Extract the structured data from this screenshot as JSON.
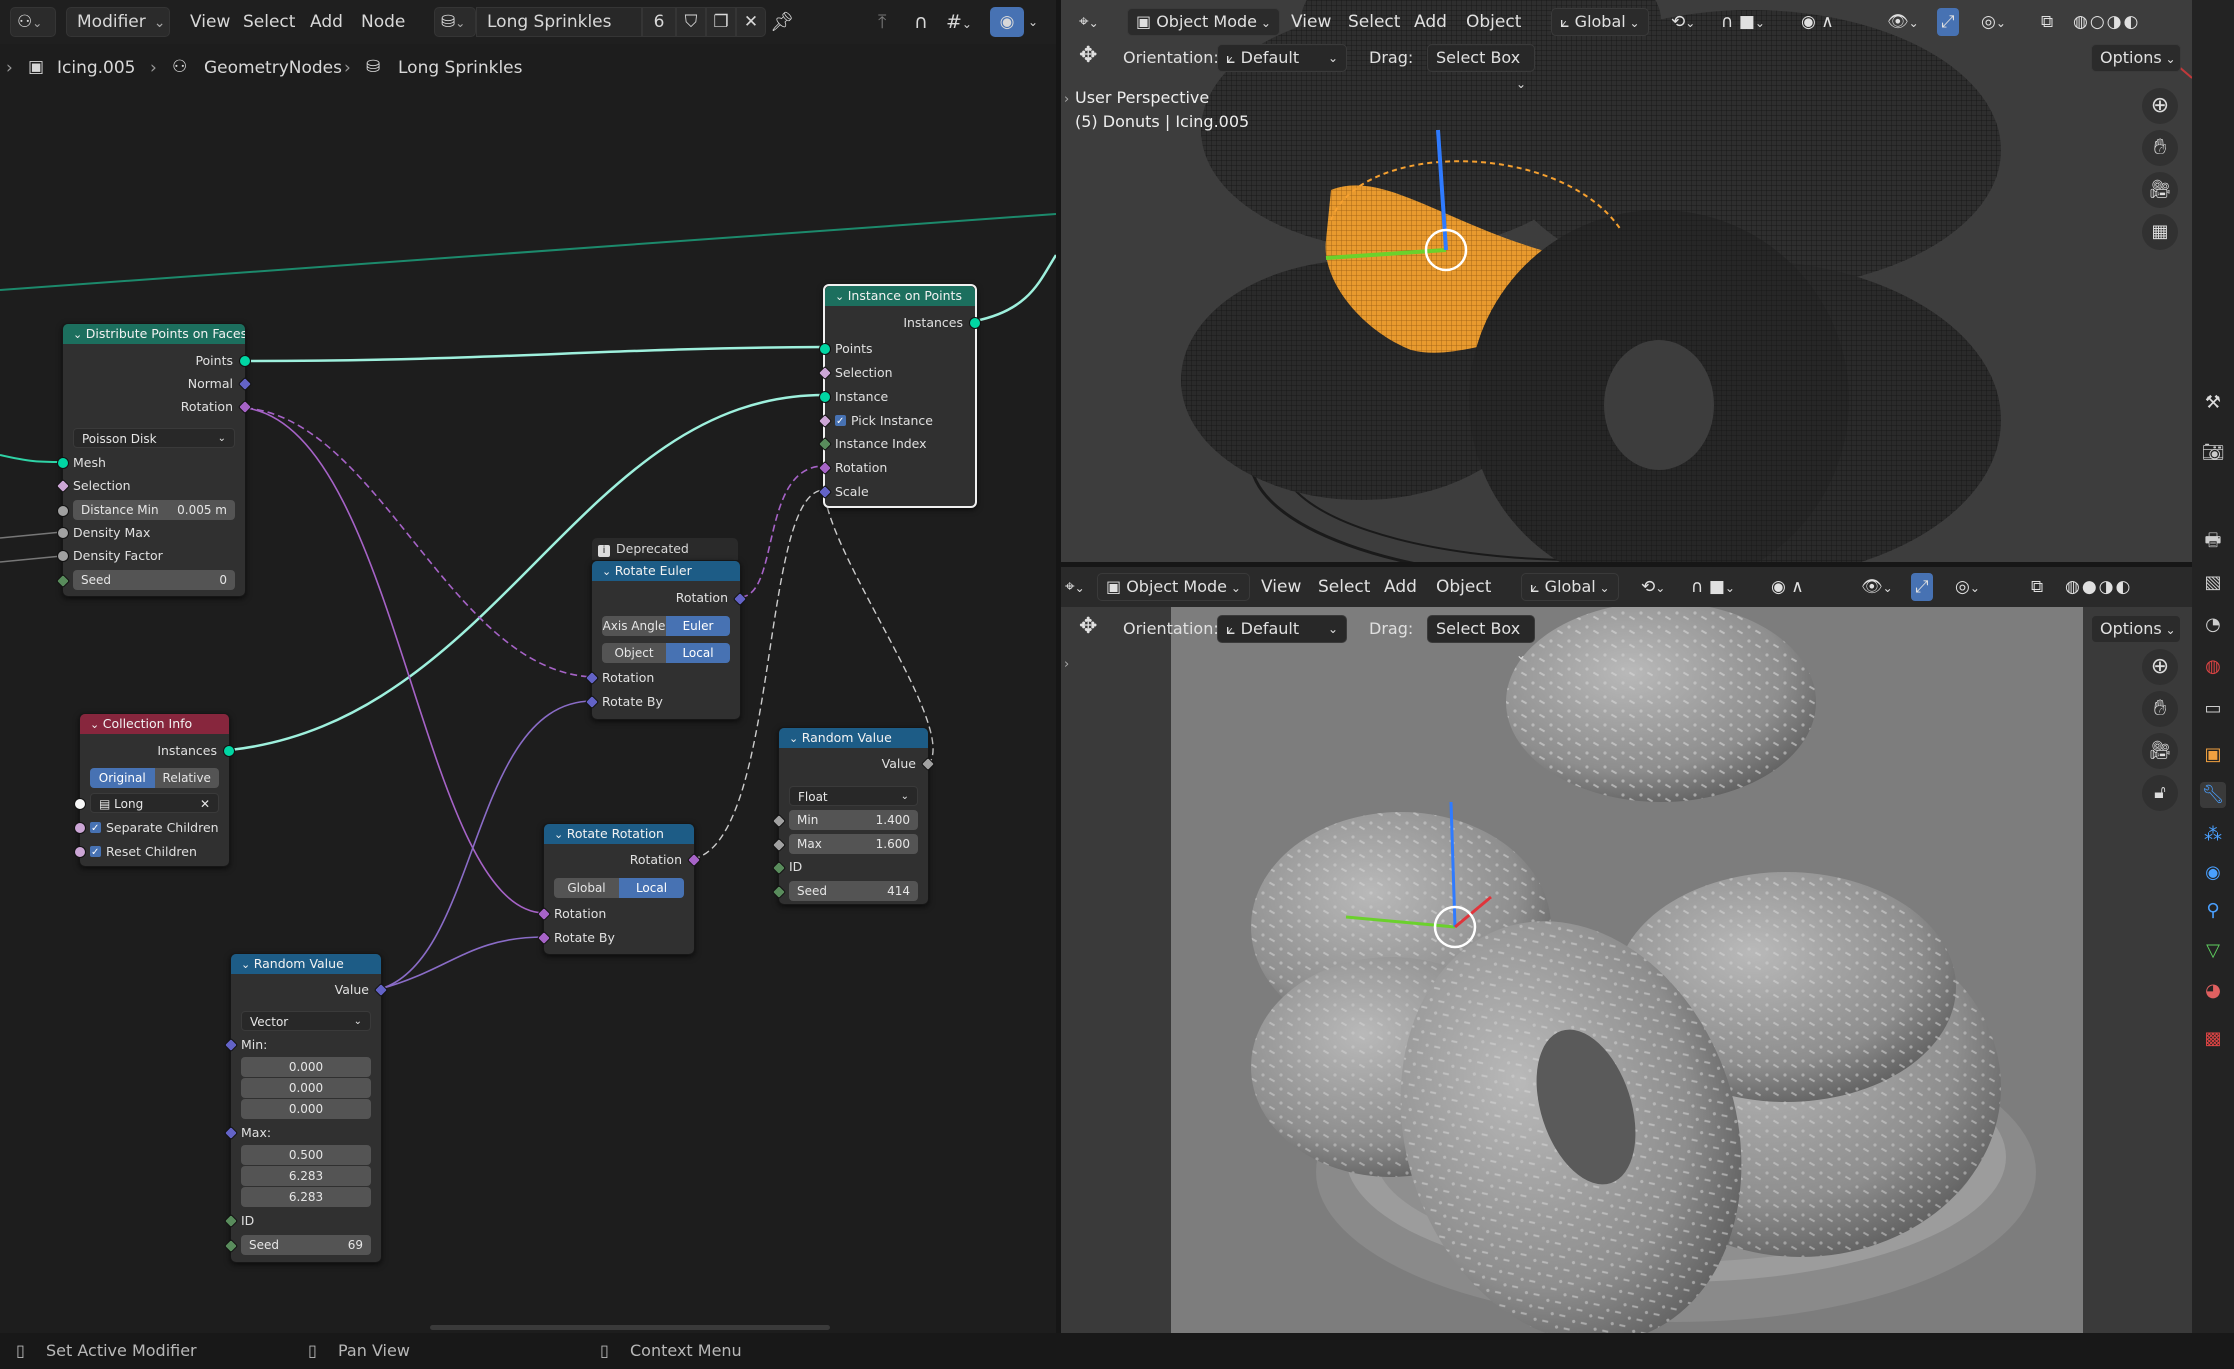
{
  "node_editor": {
    "header": {
      "editor_type_icon": "node-editor-icon",
      "modifier_dropdown": "Modifier",
      "menus": [
        "View",
        "Select",
        "Add",
        "Node"
      ],
      "node_tree_name": "Long Sprinkles",
      "user_count": "6"
    },
    "breadcrumb": [
      "Icing.005",
      "GeometryNodes",
      "Long Sprinkles"
    ],
    "nodes": {
      "distribute": {
        "title": "Distribute Points on Faces",
        "outputs": [
          "Points",
          "Normal",
          "Rotation"
        ],
        "mode": "Poisson Disk",
        "inputs": [
          "Mesh",
          "Selection"
        ],
        "distance_min_label": "Distance Min",
        "distance_min_value": "0.005 m",
        "density_max": "Density Max",
        "density_factor": "Density Factor",
        "seed_label": "Seed",
        "seed_value": "0"
      },
      "instance_on_points": {
        "title": "Instance on Points",
        "output": "Instances",
        "inputs": [
          "Points",
          "Selection",
          "Instance",
          "Pick Instance",
          "Instance Index",
          "Rotation",
          "Scale"
        ]
      },
      "collection_info": {
        "title": "Collection Info",
        "output": "Instances",
        "toggle": [
          "Original",
          "Relative"
        ],
        "collection": "Long",
        "separate_children": "Separate Children",
        "reset_children": "Reset Children"
      },
      "rotate_euler": {
        "badge": "Deprecated",
        "title": "Rotate Euler",
        "output": "Rotation",
        "type_toggle": [
          "Axis Angle",
          "Euler"
        ],
        "space_toggle": [
          "Object",
          "Local"
        ],
        "inputs": [
          "Rotation",
          "Rotate By"
        ]
      },
      "rotate_rotation": {
        "title": "Rotate Rotation",
        "output": "Rotation",
        "space_toggle": [
          "Global",
          "Local"
        ],
        "inputs": [
          "Rotation",
          "Rotate By"
        ]
      },
      "random_float": {
        "title": "Random Value",
        "output": "Value",
        "type": "Float",
        "min_label": "Min",
        "min_value": "1.400",
        "max_label": "Max",
        "max_value": "1.600",
        "id_label": "ID",
        "seed_label": "Seed",
        "seed_value": "414"
      },
      "random_vector": {
        "title": "Random Value",
        "output": "Value",
        "type": "Vector",
        "min_label": "Min:",
        "min_values": [
          "0.000",
          "0.000",
          "0.000"
        ],
        "max_label": "Max:",
        "max_values": [
          "0.500",
          "6.283",
          "6.283"
        ],
        "id_label": "ID",
        "seed_label": "Seed",
        "seed_value": "69"
      }
    }
  },
  "viewport_top": {
    "mode": "Object Mode",
    "menus": [
      "View",
      "Select",
      "Add",
      "Object"
    ],
    "transform_orientation": "Global",
    "orientation_label": "Orientation:",
    "orientation_value": "Default",
    "drag_label": "Drag:",
    "drag_value": "Select Box",
    "options": "Options",
    "overlay_line1": "User Perspective",
    "overlay_line2": "(5) Donuts | Icing.005"
  },
  "viewport_bottom": {
    "mode": "Object Mode",
    "menus": [
      "View",
      "Select",
      "Add",
      "Object"
    ],
    "transform_orientation": "Global",
    "orientation_label": "Orientation:",
    "orientation_value": "Default",
    "drag_label": "Drag:",
    "drag_value": "Select Box",
    "options": "Options"
  },
  "status_bar": [
    "Set Active Modifier",
    "Pan View",
    "Context Menu"
  ],
  "colors": {
    "geometry_header": "#1c6f5e",
    "converter_header": "#1d5c86",
    "input_header": "#87263d",
    "geometry_socket": "#00d6a3",
    "rotation_socket": "#a663c7",
    "vector_socket": "#6363c7",
    "float_socket": "#a1a1a1",
    "int_socket": "#598c5c",
    "boolean_socket": "#cca6d6",
    "selection_orange": "#f5a030",
    "accent_blue": "#4772b3"
  }
}
